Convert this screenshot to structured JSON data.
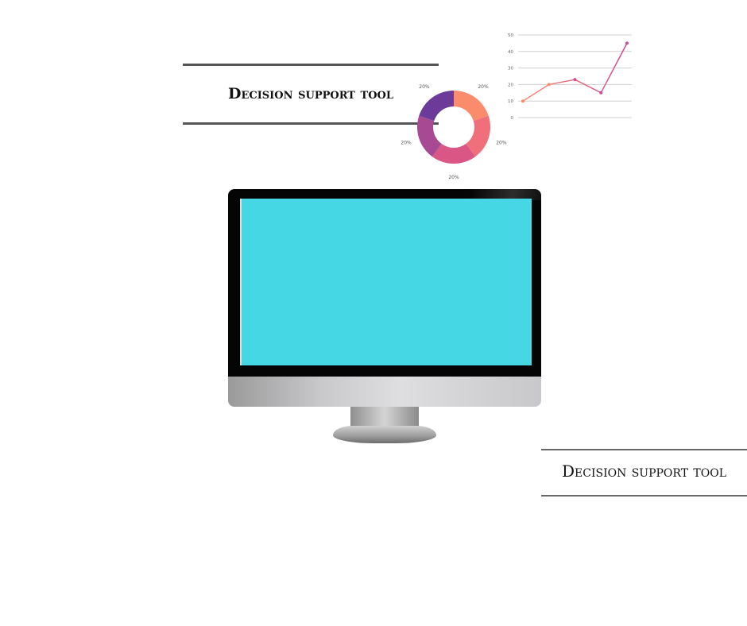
{
  "title_top": "Decision support tool",
  "title_bottom": "Decision support tool",
  "donut": {
    "labels": [
      "20%",
      "20%",
      "20%",
      "20%",
      "20%"
    ],
    "values": [
      20,
      20,
      20,
      20,
      20
    ],
    "colors": [
      "#fb8c6b",
      "#ef6f7a",
      "#d95685",
      "#a84a93",
      "#6c3b9a"
    ]
  },
  "chart_data": {
    "type": "line",
    "x": [
      1,
      2,
      3,
      4,
      5
    ],
    "values": [
      10,
      20,
      23,
      15,
      45
    ],
    "y_ticks": [
      "0",
      "10",
      "20",
      "30",
      "40",
      "50"
    ],
    "ylim": [
      0,
      50
    ],
    "grid": true,
    "colors": {
      "start": "#fb8c6b",
      "end": "#d14a92"
    }
  },
  "monitor": {
    "screen_color": "#45d8e4"
  }
}
